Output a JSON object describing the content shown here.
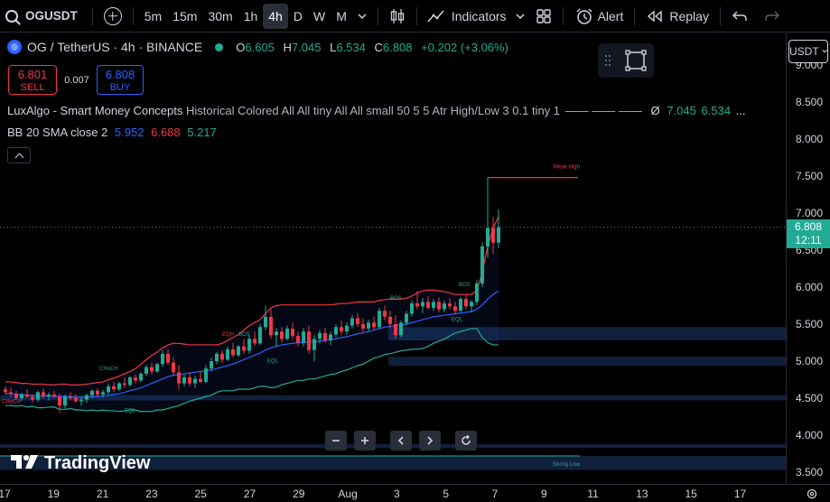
{
  "toolbar": {
    "symbol": "OGUSDT",
    "timeframes": [
      "5m",
      "15m",
      "30m",
      "1h",
      "4h",
      "D",
      "W",
      "M"
    ],
    "active_timeframe": "4h",
    "indicators_label": "Indicators",
    "alert_label": "Alert",
    "replay_label": "Replay"
  },
  "legend": {
    "title": "OG / TetherUS · 4h · BINANCE",
    "open_key": "O",
    "open": "6.605",
    "high_key": "H",
    "high": "7.045",
    "low_key": "L",
    "low": "6.534",
    "close_key": "C",
    "close": "6.808",
    "change": "+0.202 (+3.06%)"
  },
  "trade": {
    "sell_price": "6.801",
    "sell_label": "SELL",
    "spread": "0.007",
    "buy_price": "6.808",
    "buy_label": "BUY"
  },
  "indicators": {
    "smc_name": "LuxAlgo - Smart Money Concepts",
    "smc_params": "Historical Colored All All tiny All All small 50 5 5 Atr High/Low 3 0.1 tiny 1",
    "smc_dashes": "—— —— ——",
    "smc_symbol": "Ø",
    "smc_v1": "7.045",
    "smc_v2": "6.534",
    "smc_more": "...",
    "bb_name": "BB 20 SMA close 2",
    "bb_v1": "5.952",
    "bb_v2": "6.688",
    "bb_v3": "5.217"
  },
  "price_axis": {
    "currency": "USDT",
    "ticks": [
      "9.000",
      "8.500",
      "8.000",
      "7.500",
      "7.000",
      "6.500",
      "6.000",
      "5.500",
      "5.000",
      "4.500",
      "4.000",
      "3.500"
    ],
    "current_price": "6.808",
    "countdown": "12:11"
  },
  "time_axis": {
    "ticks": [
      "17",
      "19",
      "21",
      "23",
      "25",
      "27",
      "29",
      "Aug",
      "3",
      "5",
      "7",
      "9",
      "11",
      "13",
      "15",
      "17"
    ]
  },
  "annotations": {
    "weak_high": "Weak High",
    "strong_low": "Strong Low",
    "bos": "BOS",
    "choch": "CHoCH",
    "eqh": "EQH",
    "eql": "EQL"
  },
  "branding": {
    "name": "TradingView"
  },
  "colors": {
    "up": "#22ab94",
    "down": "#f23645",
    "bb_upper": "#f23645",
    "bb_basis": "#2962ff",
    "bb_lower": "#22ab94",
    "zone": "#1e3a6e"
  },
  "chart_data": {
    "type": "candlestick",
    "price_range": [
      3.4,
      9.2
    ],
    "candles": [
      [
        4.62,
        4.66,
        4.55,
        4.58
      ],
      [
        4.58,
        4.64,
        4.52,
        4.56
      ],
      [
        4.56,
        4.6,
        4.48,
        4.5
      ],
      [
        4.5,
        4.57,
        4.46,
        4.55
      ],
      [
        4.55,
        4.62,
        4.51,
        4.52
      ],
      [
        4.52,
        4.55,
        4.44,
        4.48
      ],
      [
        4.48,
        4.6,
        4.45,
        4.58
      ],
      [
        4.58,
        4.63,
        4.5,
        4.53
      ],
      [
        4.53,
        4.58,
        4.47,
        4.55
      ],
      [
        4.55,
        4.6,
        4.5,
        4.52
      ],
      [
        4.52,
        4.56,
        4.3,
        4.4
      ],
      [
        4.4,
        4.55,
        4.36,
        4.52
      ],
      [
        4.52,
        4.58,
        4.47,
        4.5
      ],
      [
        4.5,
        4.55,
        4.44,
        4.46
      ],
      [
        4.46,
        4.52,
        4.4,
        4.48
      ],
      [
        4.48,
        4.56,
        4.44,
        4.54
      ],
      [
        4.54,
        4.62,
        4.5,
        4.6
      ],
      [
        4.6,
        4.63,
        4.52,
        4.55
      ],
      [
        4.55,
        4.61,
        4.51,
        4.58
      ],
      [
        4.58,
        4.7,
        4.55,
        4.66
      ],
      [
        4.66,
        4.72,
        4.58,
        4.62
      ],
      [
        4.62,
        4.72,
        4.6,
        4.7
      ],
      [
        4.7,
        4.78,
        4.64,
        4.68
      ],
      [
        4.68,
        4.8,
        4.66,
        4.78
      ],
      [
        4.78,
        4.82,
        4.7,
        4.74
      ],
      [
        4.74,
        4.85,
        4.72,
        4.83
      ],
      [
        4.83,
        4.95,
        4.8,
        4.92
      ],
      [
        4.92,
        4.98,
        4.82,
        4.86
      ],
      [
        4.86,
        4.98,
        4.84,
        4.96
      ],
      [
        4.96,
        5.15,
        4.92,
        5.1
      ],
      [
        5.1,
        5.16,
        4.95,
        4.98
      ],
      [
        4.98,
        5.05,
        4.8,
        4.85
      ],
      [
        4.85,
        4.95,
        4.62,
        4.7
      ],
      [
        4.7,
        4.82,
        4.66,
        4.78
      ],
      [
        4.78,
        4.85,
        4.66,
        4.7
      ],
      [
        4.7,
        4.8,
        4.64,
        4.76
      ],
      [
        4.76,
        4.86,
        4.7,
        4.72
      ],
      [
        4.72,
        4.95,
        4.7,
        4.9
      ],
      [
        4.9,
        5.05,
        4.86,
        5.0
      ],
      [
        5.0,
        5.12,
        4.96,
        5.1
      ],
      [
        5.1,
        5.15,
        4.98,
        5.02
      ],
      [
        5.02,
        5.2,
        5.0,
        5.16
      ],
      [
        5.16,
        5.25,
        5.05,
        5.08
      ],
      [
        5.08,
        5.22,
        5.06,
        5.2
      ],
      [
        5.2,
        5.3,
        5.1,
        5.14
      ],
      [
        5.14,
        5.35,
        5.1,
        5.3
      ],
      [
        5.3,
        5.4,
        5.2,
        5.24
      ],
      [
        5.24,
        5.5,
        5.22,
        5.46
      ],
      [
        5.46,
        5.75,
        5.42,
        5.6
      ],
      [
        5.6,
        5.7,
        5.3,
        5.35
      ],
      [
        5.35,
        5.45,
        5.2,
        5.4
      ],
      [
        5.4,
        5.46,
        5.25,
        5.3
      ],
      [
        5.3,
        5.48,
        5.28,
        5.44
      ],
      [
        5.44,
        5.52,
        5.3,
        5.34
      ],
      [
        5.34,
        5.4,
        5.2,
        5.25
      ],
      [
        5.25,
        5.45,
        5.2,
        5.4
      ],
      [
        5.4,
        5.48,
        5.1,
        5.15
      ],
      [
        5.15,
        5.35,
        5.0,
        5.3
      ],
      [
        5.3,
        5.42,
        5.24,
        5.38
      ],
      [
        5.38,
        5.45,
        5.25,
        5.28
      ],
      [
        5.28,
        5.4,
        5.22,
        5.36
      ],
      [
        5.36,
        5.5,
        5.32,
        5.46
      ],
      [
        5.46,
        5.55,
        5.35,
        5.4
      ],
      [
        5.4,
        5.52,
        5.36,
        5.48
      ],
      [
        5.48,
        5.62,
        5.44,
        5.58
      ],
      [
        5.58,
        5.65,
        5.46,
        5.5
      ],
      [
        5.5,
        5.58,
        5.38,
        5.44
      ],
      [
        5.44,
        5.56,
        5.4,
        5.52
      ],
      [
        5.52,
        5.6,
        5.42,
        5.46
      ],
      [
        5.46,
        5.72,
        5.44,
        5.68
      ],
      [
        5.68,
        5.75,
        5.55,
        5.6
      ],
      [
        5.6,
        5.68,
        5.45,
        5.5
      ],
      [
        5.5,
        5.62,
        5.3,
        5.35
      ],
      [
        5.35,
        5.55,
        5.32,
        5.52
      ],
      [
        5.52,
        5.68,
        5.48,
        5.64
      ],
      [
        5.64,
        5.82,
        5.6,
        5.78
      ],
      [
        5.78,
        5.95,
        5.7,
        5.74
      ],
      [
        5.74,
        5.85,
        5.65,
        5.8
      ],
      [
        5.8,
        5.88,
        5.7,
        5.72
      ],
      [
        5.72,
        5.84,
        5.68,
        5.8
      ],
      [
        5.8,
        5.86,
        5.66,
        5.7
      ],
      [
        5.7,
        5.82,
        5.66,
        5.78
      ],
      [
        5.78,
        5.85,
        5.7,
        5.74
      ],
      [
        5.74,
        5.8,
        5.64,
        5.68
      ],
      [
        5.68,
        5.86,
        5.66,
        5.84
      ],
      [
        5.84,
        5.9,
        5.7,
        5.74
      ],
      [
        5.74,
        5.82,
        5.66,
        5.8
      ],
      [
        5.8,
        6.1,
        5.76,
        6.05
      ],
      [
        6.05,
        6.6,
        6.0,
        6.55
      ],
      [
        6.55,
        7.48,
        6.4,
        6.8
      ],
      [
        6.8,
        6.95,
        6.45,
        6.6
      ],
      [
        6.6,
        7.05,
        6.53,
        6.81
      ]
    ],
    "bb_upper": [
      4.72,
      4.72,
      4.71,
      4.7,
      4.7,
      4.69,
      4.69,
      4.69,
      4.68,
      4.68,
      4.69,
      4.69,
      4.68,
      4.68,
      4.68,
      4.69,
      4.7,
      4.71,
      4.72,
      4.75,
      4.77,
      4.8,
      4.83,
      4.86,
      4.9,
      4.96,
      5.02,
      5.08,
      5.12,
      5.18,
      5.22,
      5.24,
      5.24,
      5.23,
      5.22,
      5.22,
      5.22,
      5.22,
      5.22,
      5.22,
      5.24,
      5.28,
      5.32,
      5.36,
      5.42,
      5.48,
      5.52,
      5.56,
      5.64,
      5.72,
      5.75,
      5.76,
      5.76,
      5.76,
      5.76,
      5.76,
      5.76,
      5.76,
      5.76,
      5.76,
      5.76,
      5.77,
      5.78,
      5.78,
      5.79,
      5.8,
      5.8,
      5.8,
      5.8,
      5.82,
      5.83,
      5.84,
      5.84,
      5.84,
      5.85,
      5.88,
      5.92,
      5.95,
      5.96,
      5.96,
      5.95,
      5.94,
      5.92,
      5.9,
      5.9,
      5.9,
      5.9,
      5.96,
      6.2,
      6.55,
      6.8,
      6.95
    ],
    "bb_basis": [
      4.56,
      4.56,
      4.55,
      4.55,
      4.54,
      4.54,
      4.53,
      4.53,
      4.53,
      4.53,
      4.52,
      4.52,
      4.52,
      4.51,
      4.51,
      4.51,
      4.52,
      4.52,
      4.53,
      4.54,
      4.55,
      4.56,
      4.58,
      4.6,
      4.62,
      4.64,
      4.67,
      4.7,
      4.73,
      4.76,
      4.79,
      4.81,
      4.82,
      4.83,
      4.84,
      4.85,
      4.86,
      4.87,
      4.88,
      4.9,
      4.92,
      4.94,
      4.96,
      4.99,
      5.02,
      5.05,
      5.08,
      5.11,
      5.15,
      5.18,
      5.2,
      5.22,
      5.23,
      5.24,
      5.25,
      5.25,
      5.26,
      5.26,
      5.27,
      5.28,
      5.29,
      5.3,
      5.32,
      5.33,
      5.35,
      5.37,
      5.38,
      5.4,
      5.42,
      5.44,
      5.46,
      5.47,
      5.48,
      5.49,
      5.5,
      5.52,
      5.54,
      5.56,
      5.58,
      5.6,
      5.61,
      5.62,
      5.63,
      5.64,
      5.65,
      5.66,
      5.67,
      5.7,
      5.76,
      5.84,
      5.9,
      5.95
    ],
    "bb_lower": [
      4.4,
      4.4,
      4.39,
      4.4,
      4.38,
      4.39,
      4.37,
      4.37,
      4.38,
      4.38,
      4.35,
      4.35,
      4.36,
      4.34,
      4.34,
      4.33,
      4.34,
      4.33,
      4.34,
      4.33,
      4.33,
      4.32,
      4.33,
      4.34,
      4.34,
      4.32,
      4.32,
      4.32,
      4.34,
      4.34,
      4.36,
      4.38,
      4.4,
      4.43,
      4.46,
      4.48,
      4.5,
      4.52,
      4.54,
      4.58,
      4.6,
      4.6,
      4.6,
      4.62,
      4.62,
      4.62,
      4.64,
      4.66,
      4.66,
      4.64,
      4.65,
      4.68,
      4.7,
      4.72,
      4.74,
      4.74,
      4.76,
      4.76,
      4.78,
      4.8,
      4.82,
      4.83,
      4.86,
      4.88,
      4.91,
      4.94,
      4.96,
      5.0,
      5.04,
      5.06,
      5.09,
      5.1,
      5.12,
      5.14,
      5.15,
      5.16,
      5.16,
      5.17,
      5.2,
      5.24,
      5.27,
      5.3,
      5.34,
      5.38,
      5.4,
      5.42,
      5.44,
      5.44,
      5.32,
      5.25,
      5.22,
      5.22
    ],
    "zones": [
      [
        5.28,
        5.46
      ],
      [
        4.94,
        5.06
      ],
      [
        4.47,
        4.54
      ],
      [
        3.83,
        3.88
      ],
      [
        3.53,
        3.72
      ]
    ],
    "weak_high": 7.48,
    "current_price": 6.808
  }
}
